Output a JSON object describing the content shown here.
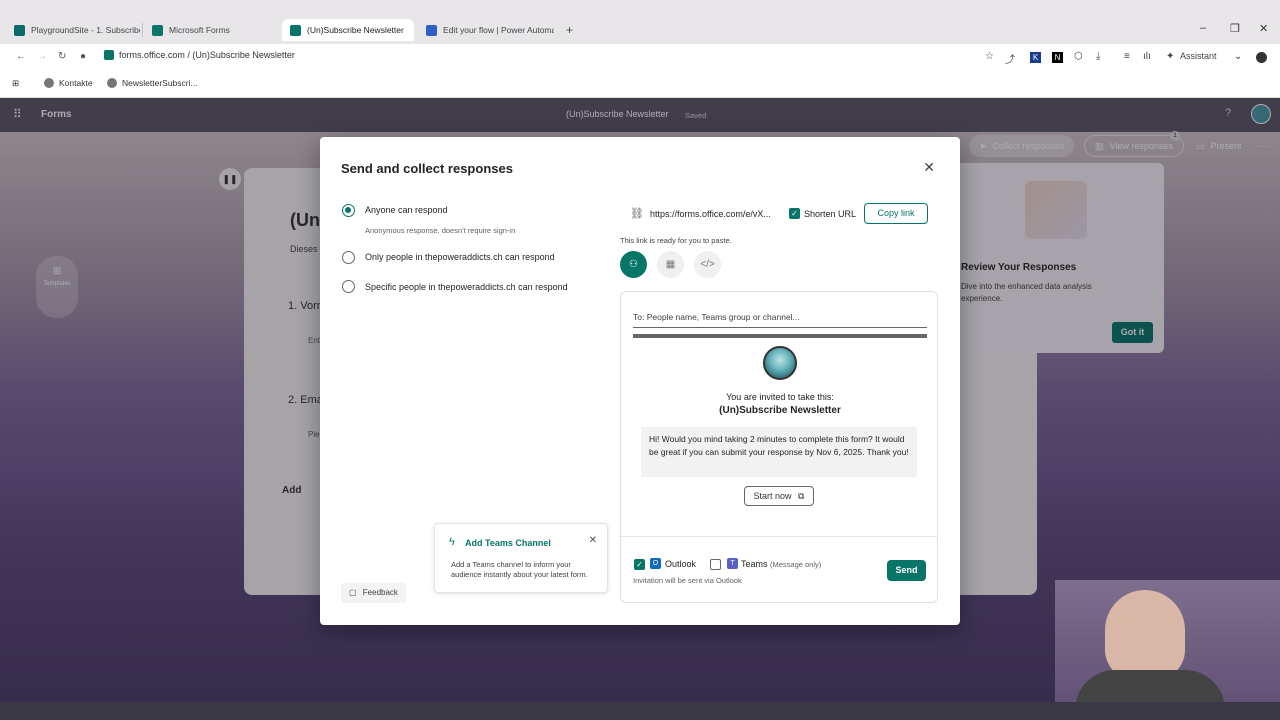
{
  "browser": {
    "tabs": [
      {
        "label": "PlaygroundSite - 1. Subscribe",
        "color": "#0b6a6a"
      },
      {
        "label": "Microsoft Forms",
        "color": "#077568"
      },
      {
        "label": "(Un)Subscribe Newsletter",
        "color": "#077568"
      },
      {
        "label": "Edit your flow | Power Automate",
        "color": "#2f5fc4"
      }
    ],
    "new_tab": "+",
    "address": "forms.office.com / (Un)Subscribe Newsletter",
    "assistant": "Assistant",
    "bookmarks": [
      "Kontakte",
      "NewsletterSubscri..."
    ]
  },
  "forms_header": {
    "app_name": "Forms",
    "form_title": "(Un)Subscribe Newsletter",
    "saved": "Saved",
    "collect": "Collect responses",
    "view": "View responses",
    "view_badge": "1",
    "present": "Present",
    "more": "···",
    "help": "?"
  },
  "background": {
    "templates": "Templates",
    "form_title_partial": "(Un",
    "desc_partial": "Dieses l",
    "q1": "1. Vorn",
    "q1_input": "Ent",
    "q2": "2. Ema",
    "q2_input": "Ple",
    "add": "Add",
    "review_title": "Review Your Responses",
    "review_body": "Dive into the enhanced data analysis experience.",
    "got_it": "Got it"
  },
  "modal": {
    "title": "Send and collect responses",
    "options": [
      {
        "label": "Anyone can respond",
        "sub": "Anonymous response, doesn't require sign-in",
        "selected": true
      },
      {
        "label": "Only people in thepoweraddicts.ch can respond",
        "selected": false
      },
      {
        "label": "Specific people in thepoweraddicts.ch can respond",
        "selected": false
      }
    ],
    "link_url": "https://forms.office.com/e/vX...",
    "shorten": "Shorten URL",
    "copy": "Copy link",
    "ready": "This link is ready for you to paste.",
    "to_placeholder": "To: People name, Teams group or channel...",
    "invited": "You are invited to take this:",
    "form_name": "(Un)Subscribe Newsletter",
    "message": "Hi! Would you mind taking 2 minutes to complete this form? It would be great if you can submit your response by Nov 6, 2025. Thank you!",
    "start_now": "Start now",
    "outlook": "Outlook",
    "teams": "Teams",
    "teams_note": "(Message only)",
    "send": "Send",
    "via": "Invitation will be sent via Outlook",
    "teams_card_title": "Add Teams Channel",
    "teams_card_body": "Add a Teams channel to inform your audience instantly about your latest form.",
    "feedback": "Feedback"
  }
}
